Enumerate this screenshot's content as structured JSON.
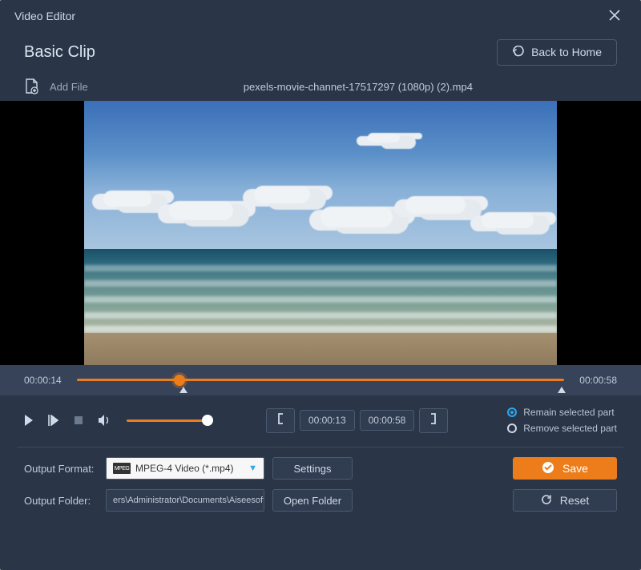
{
  "window": {
    "title": "Video Editor"
  },
  "header": {
    "page_title": "Basic Clip",
    "back_label": "Back to Home"
  },
  "file": {
    "add_label": "Add File",
    "current_name": "pexels-movie-channet-17517297 (1080p) (2).mp4"
  },
  "timeline": {
    "current_time": "00:00:14",
    "total_time": "00:00:58",
    "progress_pct": 21
  },
  "trim": {
    "start_time": "00:00:13",
    "end_time": "00:00:58"
  },
  "mode": {
    "remain_label": "Remain selected part",
    "remove_label": "Remove selected part",
    "selected": "remain"
  },
  "output": {
    "format_label": "Output Format:",
    "format_value": "MPEG-4 Video (*.mp4)",
    "settings_label": "Settings",
    "folder_label": "Output Folder:",
    "folder_value": "ers\\Administrator\\Documents\\Aiseesoft Studio\\Video",
    "open_folder_label": "Open Folder",
    "save_label": "Save",
    "reset_label": "Reset"
  },
  "icons": {
    "mpeg": "MPEG"
  }
}
